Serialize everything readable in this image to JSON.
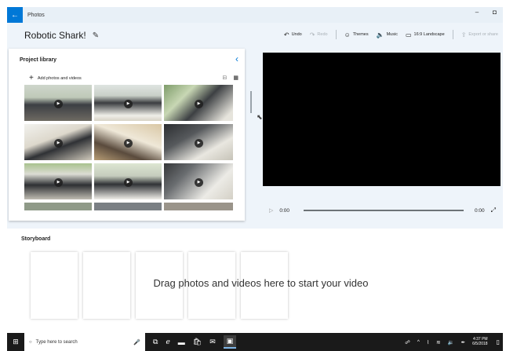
{
  "app": {
    "name": "Photos",
    "back_glyph": "←",
    "minimize_glyph": "–",
    "maximize_glyph": "◘"
  },
  "project": {
    "title": "Robotic Shark!",
    "edit_icon": "pencil-icon"
  },
  "toolbar": {
    "undo": "Undo",
    "redo": "Redo",
    "themes": "Themes",
    "music": "Music",
    "aspect": "16:9 Landscape",
    "export": "Export or share"
  },
  "library": {
    "title": "Project library",
    "add_label": "Add photos and videos",
    "thumbnails": [
      {
        "kind": "video"
      },
      {
        "kind": "video"
      },
      {
        "kind": "video"
      },
      {
        "kind": "video"
      },
      {
        "kind": "video"
      },
      {
        "kind": "video"
      },
      {
        "kind": "video"
      },
      {
        "kind": "video"
      },
      {
        "kind": "video"
      },
      {
        "kind": "video"
      },
      {
        "kind": "video"
      },
      {
        "kind": "video"
      }
    ]
  },
  "player": {
    "current_time": "0:00",
    "total_time": "0:00"
  },
  "storyboard": {
    "title": "Storyboard",
    "hint": "Drag photos and videos here to start your video",
    "slot_count": 5
  },
  "taskbar": {
    "search_placeholder": "Type here to search",
    "time": "4:37 PM",
    "date": "6/5/2018"
  },
  "colors": {
    "accent": "#0078d7",
    "preview_bg": "#000000",
    "taskbar_bg": "#1a1a1a"
  }
}
